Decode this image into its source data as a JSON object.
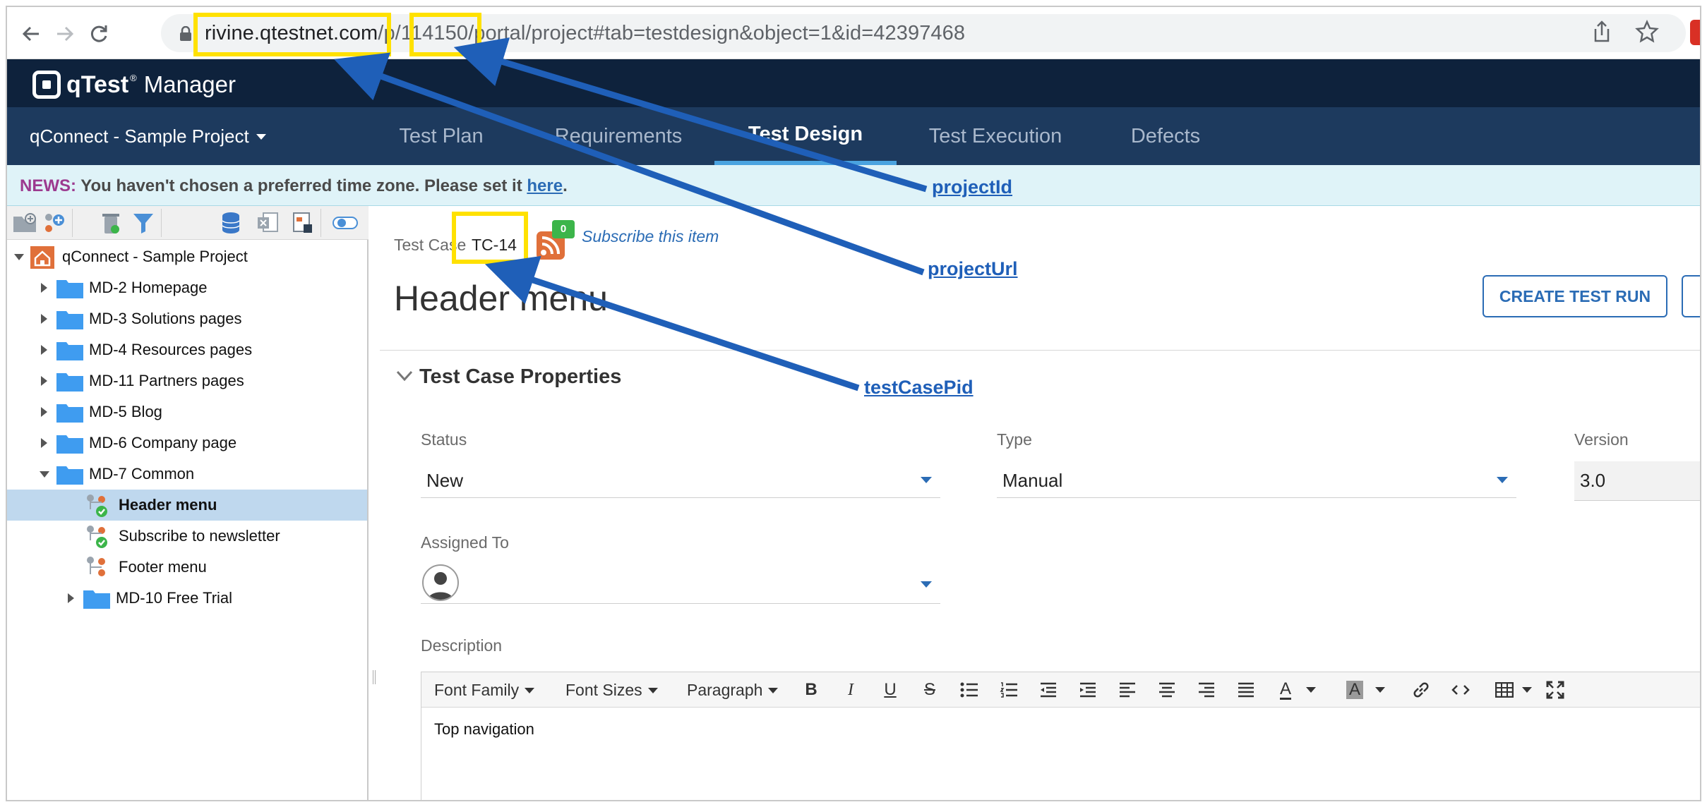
{
  "browser": {
    "url_host": "rivine.qtestnet.com",
    "url_sep1": "/p/",
    "url_project": "114150",
    "url_rest": "/portal/project#tab=testdesign&object=1&id=42397468"
  },
  "app": {
    "logo_text": "qTest",
    "logo_reg": "®",
    "product": "Manager",
    "project_name": "qConnect - Sample Project",
    "tabs": [
      {
        "label": "Test Plan"
      },
      {
        "label": "Requirements"
      },
      {
        "label": "Test Design",
        "active": true
      },
      {
        "label": "Test Execution"
      },
      {
        "label": "Defects"
      }
    ]
  },
  "news": {
    "label": "NEWS:",
    "message": " You haven't chosen a preferred time zone. Please set it ",
    "link": "here",
    "end": "."
  },
  "tree": {
    "root": "qConnect - Sample Project",
    "items": [
      {
        "label": "MD-2 Homepage"
      },
      {
        "label": "MD-3 Solutions pages"
      },
      {
        "label": "MD-4 Resources pages"
      },
      {
        "label": "MD-11 Partners pages"
      },
      {
        "label": "MD-5 Blog"
      },
      {
        "label": "MD-6 Company page"
      },
      {
        "label": "MD-7 Common"
      },
      {
        "label": "Header menu"
      },
      {
        "label": "Subscribe to newsletter"
      },
      {
        "label": "Footer menu"
      },
      {
        "label": "MD-10 Free Trial"
      }
    ]
  },
  "testcase": {
    "caption": "Test Case",
    "id": "TC-14",
    "subscribers": "0",
    "subscribe_label": "Subscribe this item",
    "title": "Header menu",
    "create_run_label": "CREATE TEST RUN",
    "section_title": "Test Case Properties",
    "status_label": "Status",
    "status_value": "New",
    "type_label": "Type",
    "type_value": "Manual",
    "version_label": "Version",
    "version_value": "3.0",
    "assigned_label": "Assigned To",
    "description_label": "Description",
    "description_value": "Top navigation"
  },
  "editor": {
    "font_family": "Font Family",
    "font_sizes": "Font Sizes",
    "paragraph": "Paragraph",
    "bold": "B",
    "italic": "I",
    "underline": "U",
    "strike": "S",
    "text_color": "A",
    "bg_color": "A"
  },
  "annotations": {
    "project_id": "projectId",
    "project_url": "projectUrl",
    "test_case_pid": "testCasePid",
    "highlight_color": "#ffe100",
    "arrow_color": "#1f5fb8"
  }
}
